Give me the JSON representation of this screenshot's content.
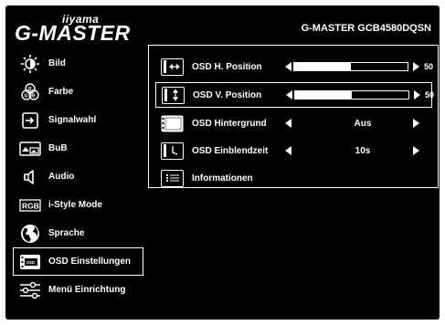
{
  "header": {
    "brand_small": "iiyama",
    "brand_main": "G-MASTER",
    "model": "G-MASTER GCB4580DQSN"
  },
  "sidebar": {
    "items": [
      {
        "label": "Bild",
        "icon": "brightness-icon"
      },
      {
        "label": "Farbe",
        "icon": "rgb-color-icon"
      },
      {
        "label": "Signalwahl",
        "icon": "input-select-icon"
      },
      {
        "label": "BuB",
        "icon": "picture-by-picture-icon"
      },
      {
        "label": "Audio",
        "icon": "speaker-icon"
      },
      {
        "label": "i-Style Mode",
        "icon": "rgb-mode-icon"
      },
      {
        "label": "Sprache",
        "icon": "globe-icon"
      },
      {
        "label": "OSD Einstellungen",
        "icon": "osd-icon",
        "active": true
      },
      {
        "label": "Menü Einrichtung",
        "icon": "sliders-icon"
      }
    ]
  },
  "panel": {
    "rows": [
      {
        "label": "OSD H. Position",
        "icon": "horizontal-arrows-icon",
        "type": "slider",
        "value": 50,
        "min": 0,
        "max": 100
      },
      {
        "label": "OSD V. Position",
        "icon": "vertical-arrows-icon",
        "type": "slider",
        "value": 50,
        "min": 0,
        "max": 100,
        "active": true
      },
      {
        "label": "OSD Hintergrund",
        "icon": "checker-background-icon",
        "type": "choice",
        "value": "Aus"
      },
      {
        "label": "OSD Einblendzeit",
        "icon": "timer-icon",
        "type": "choice",
        "value": "10s"
      },
      {
        "label": "Informationen",
        "icon": "info-list-icon",
        "type": "info"
      }
    ]
  },
  "colors": {
    "background": "#000000",
    "foreground": "#ffffff",
    "page": "#ffffff"
  }
}
